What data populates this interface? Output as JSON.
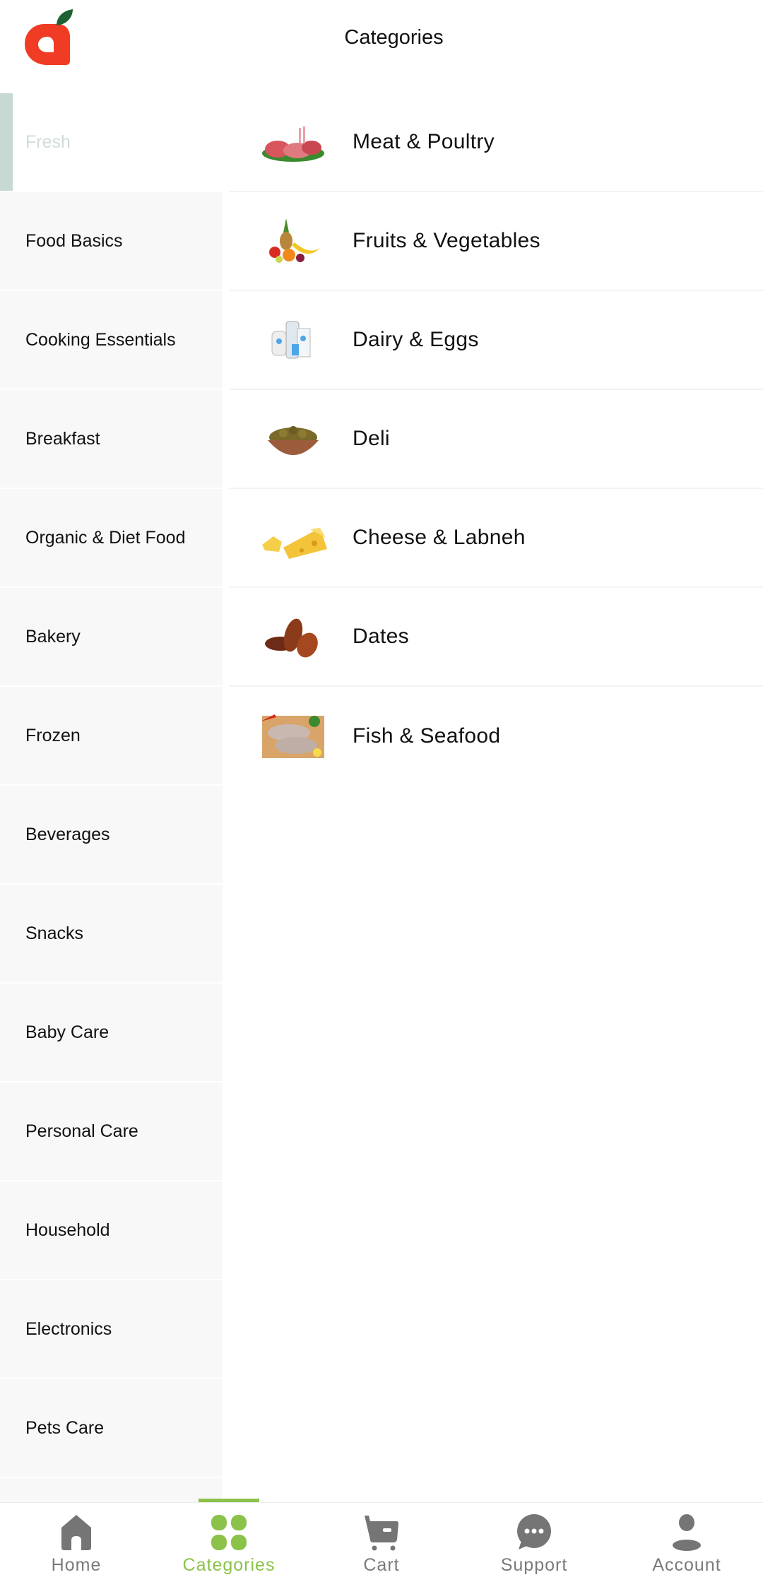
{
  "header": {
    "title": "Categories",
    "logo": "apple-logo-icon"
  },
  "colors": {
    "accent": "#8bc34a",
    "logo_red": "#f03c24",
    "logo_leaf": "#1e6234",
    "selected_bar": "#c8d8d3",
    "nav_inactive": "#7a7a7a"
  },
  "sidebar": {
    "selected": "Fresh",
    "items": [
      {
        "label": "Fresh"
      },
      {
        "label": "Food Basics"
      },
      {
        "label": "Cooking Essentials"
      },
      {
        "label": "Breakfast"
      },
      {
        "label": "Organic & Diet Food"
      },
      {
        "label": "Bakery"
      },
      {
        "label": "Frozen"
      },
      {
        "label": "Beverages"
      },
      {
        "label": "Snacks"
      },
      {
        "label": "Baby Care"
      },
      {
        "label": "Personal Care"
      },
      {
        "label": "Household"
      },
      {
        "label": "Electronics"
      },
      {
        "label": "Pets Care"
      }
    ]
  },
  "subcategories": [
    {
      "label": "Meat & Poultry",
      "icon": "meat-image"
    },
    {
      "label": "Fruits & Vegetables",
      "icon": "fruits-image"
    },
    {
      "label": "Dairy & Eggs",
      "icon": "dairy-image"
    },
    {
      "label": "Deli",
      "icon": "olives-bowl-image"
    },
    {
      "label": "Cheese & Labneh",
      "icon": "cheese-image"
    },
    {
      "label": "Dates",
      "icon": "dates-image"
    },
    {
      "label": "Fish & Seafood",
      "icon": "fish-image"
    }
  ],
  "bottom_nav": {
    "active": "Categories",
    "items": [
      {
        "label": "Home",
        "icon": "home-icon"
      },
      {
        "label": "Categories",
        "icon": "grid-icon"
      },
      {
        "label": "Cart",
        "icon": "cart-icon"
      },
      {
        "label": "Support",
        "icon": "chat-bubble-icon"
      },
      {
        "label": "Account",
        "icon": "person-icon"
      }
    ]
  }
}
